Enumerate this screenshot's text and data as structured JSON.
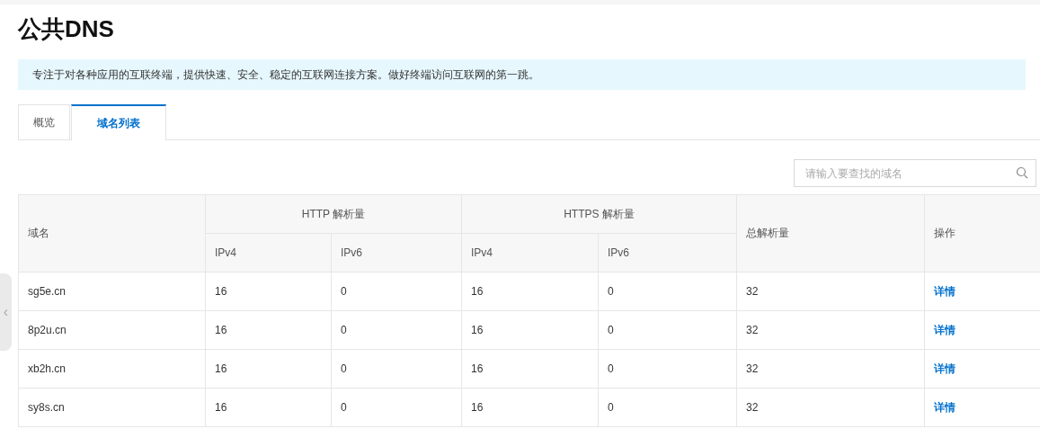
{
  "title": "公共DNS",
  "notice": "专注于对各种应用的互联终端，提供快速、安全、稳定的互联网连接方案。做好终端访问互联网的第一跳。",
  "tabs": [
    {
      "label": "概览",
      "selected": false
    },
    {
      "label": "域名列表",
      "selected": true
    }
  ],
  "search": {
    "placeholder": "请输入要查找的域名"
  },
  "table": {
    "columns": {
      "domain": "域名",
      "http": "HTTP 解析量",
      "https": "HTTPS 解析量",
      "total": "总解析量",
      "action": "操作",
      "http_sub": [
        "IPv4",
        "IPv6"
      ],
      "https_sub": [
        "IPv4",
        "IPv6"
      ]
    },
    "rows": [
      {
        "domain": "sg5e.cn",
        "http_v4": "16",
        "http_v6": "0",
        "https_v4": "16",
        "https_v6": "0",
        "total": "32",
        "action": "详情"
      },
      {
        "domain": "8p2u.cn",
        "http_v4": "16",
        "http_v6": "0",
        "https_v4": "16",
        "https_v6": "0",
        "total": "32",
        "action": "详情"
      },
      {
        "domain": "xb2h.cn",
        "http_v4": "16",
        "http_v6": "0",
        "https_v4": "16",
        "https_v6": "0",
        "total": "32",
        "action": "详情"
      },
      {
        "domain": "sy8s.cn",
        "http_v4": "16",
        "http_v6": "0",
        "https_v4": "16",
        "https_v6": "0",
        "total": "32",
        "action": "详情"
      }
    ]
  },
  "side_handle": {
    "icon": "‹"
  }
}
